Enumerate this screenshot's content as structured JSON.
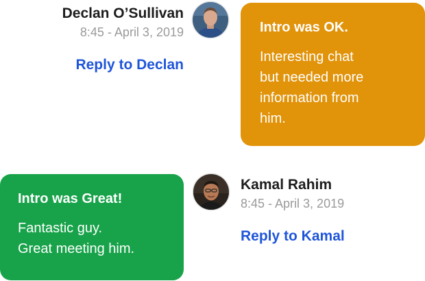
{
  "messages": [
    {
      "author": "Declan O’Sullivan",
      "timestamp": "8:45 - April 3, 2019",
      "reply_label": "Reply to Declan",
      "rating_title": "Intro was OK.",
      "comment_lines": [
        "Interesting chat",
        "but needed more",
        "information from",
        "him."
      ],
      "bubble_color": "#e1930a"
    },
    {
      "author": "Kamal Rahim",
      "timestamp": "8:45 - April 3, 2019",
      "reply_label": "Reply to Kamal",
      "rating_title": "Intro was Great!",
      "comment_lines": [
        "Fantastic guy.",
        "Great meeting him."
      ],
      "bubble_color": "#18a34a"
    }
  ],
  "colors": {
    "link": "#1f55d9",
    "name_text": "#1c1c1c",
    "timestamp_text": "#9a9a9a"
  }
}
